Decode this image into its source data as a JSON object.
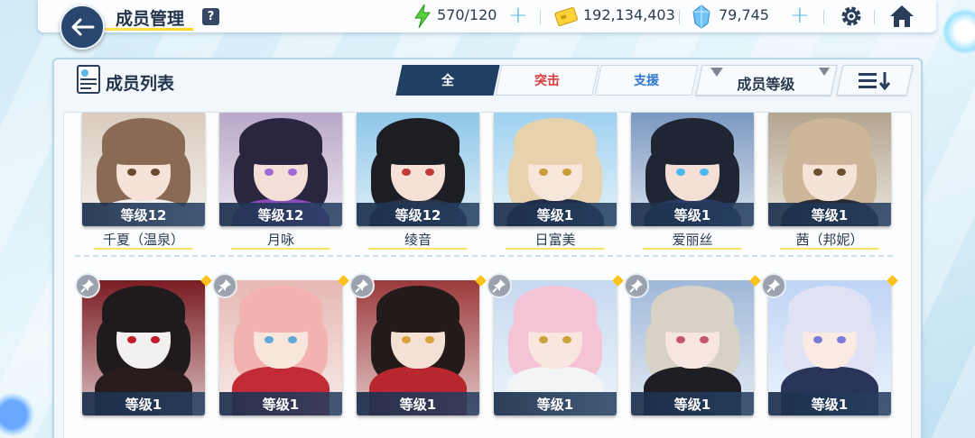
{
  "header": {
    "title": "成员管理",
    "help_label": "?",
    "resources": {
      "energy": "570/120",
      "credits": "192,134,403",
      "gems": "79,745"
    }
  },
  "panel": {
    "title": "成员列表",
    "tabs": [
      {
        "label": "全",
        "active": true
      },
      {
        "label": "突击",
        "active": false
      },
      {
        "label": "支援",
        "active": false
      }
    ],
    "sort_label": "成员等级"
  },
  "colors": {
    "accent_dark": "#213f62",
    "strike": "#d73a3a",
    "support": "#2f78d1",
    "highlight": "#ffd21e"
  },
  "row1": [
    {
      "level": "等级12",
      "name": "千夏（温泉）",
      "hair": "#8a6a55",
      "bg": "#d9cbbd",
      "skin": "#f6e2d6",
      "eye": "#6b4a32",
      "outfit": "#f2f2f2"
    },
    {
      "level": "等级12",
      "name": "月咏",
      "hair": "#2b2640",
      "bg": "#b9a8c8",
      "skin": "#f4dfd8",
      "eye": "#9b6ad6",
      "outfit": "#8a4bb8"
    },
    {
      "level": "等级12",
      "name": "绫音",
      "hair": "#1d1d24",
      "bg": "#8ec6e8",
      "skin": "#f6e1d6",
      "eye": "#c23a3a",
      "outfit": "#2a3348"
    },
    {
      "level": "等级1",
      "name": "日富美",
      "hair": "#e6d3ae",
      "bg": "#9fd1f0",
      "skin": "#f8e6da",
      "eye": "#c99b3a",
      "outfit": "#232c44"
    },
    {
      "level": "等级1",
      "name": "爱丽丝",
      "hair": "#1e2533",
      "bg": "#7b98c0",
      "skin": "#f3dfd6",
      "eye": "#4ab8f0",
      "outfit": "#2b3b62"
    },
    {
      "level": "等级1",
      "name": "茜（邦妮）",
      "hair": "#cdb79a",
      "bg": "#b3a58f",
      "skin": "#f6e3d7",
      "eye": "#6b5030",
      "outfit": "#2a2a30"
    }
  ],
  "row2": [
    {
      "level": "等级1",
      "hair": "#1e1a1e",
      "bg": "#7a1c22",
      "skin": "#f3f0f0",
      "eye": "#c21d2a",
      "outfit": "#2a1c1c"
    },
    {
      "level": "等级1",
      "hair": "#f2b2b0",
      "bg": "#e6b8b3",
      "skin": "#f8e5dc",
      "eye": "#5fa8d8",
      "outfit": "#c22a36"
    },
    {
      "level": "等级1",
      "hair": "#231a1a",
      "bg": "#9c3a3c",
      "skin": "#f5e0d4",
      "eye": "#d6a23a",
      "outfit": "#b8262e"
    },
    {
      "level": "等级1",
      "hair": "#f4c4d6",
      "bg": "#c6d9f0",
      "skin": "#f9e7df",
      "eye": "#c9a43a",
      "outfit": "#f3f4f6"
    },
    {
      "level": "等级1",
      "hair": "#d8d2c6",
      "bg": "#9fb8d8",
      "skin": "#f7e6df",
      "eye": "#c4556e",
      "outfit": "#1e1e24"
    },
    {
      "level": "等级1",
      "hair": "#dfe2f4",
      "bg": "#bfd4f5",
      "skin": "#fbeae4",
      "eye": "#7a7ad8",
      "outfit": "#2a3458"
    }
  ]
}
